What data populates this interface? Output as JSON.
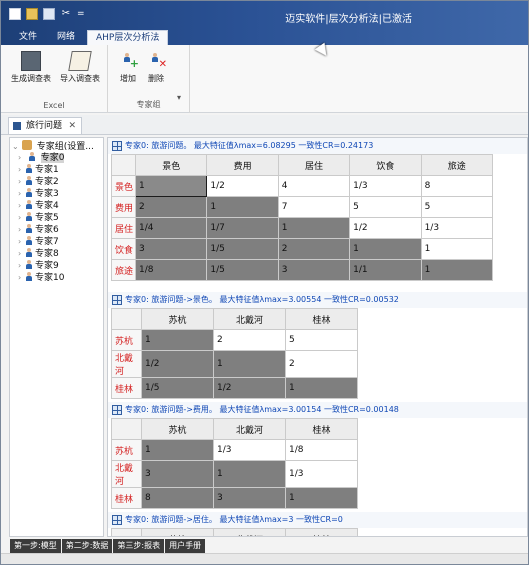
{
  "title": "迈实软件|层次分析法|已激活",
  "tabs": [
    "文件",
    "网络",
    "AHP层次分析法"
  ],
  "ribbon": {
    "excel_group": "Excel",
    "expert_group": "专家组",
    "buttons": {
      "generate": "生成调查表",
      "import": "导入调查表",
      "add": "增加",
      "delete": "删除"
    }
  },
  "document_tab": "旅行问题",
  "tree": {
    "root": "专家组(设置...",
    "items": [
      "专家0",
      "专家1",
      "专家2",
      "专家3",
      "专家4",
      "专家5",
      "专家6",
      "专家7",
      "专家8",
      "专家9",
      "专家10"
    ]
  },
  "sections": [
    {
      "title": "专家0: 旅游问题。 最大特征值λmax=6.08295 一致性CR=0.24173",
      "columns": [
        "景色",
        "费用",
        "居住",
        "饮食",
        "旅途"
      ],
      "rows": [
        [
          "景色",
          "1",
          "1/2",
          "4",
          "1/3",
          "8"
        ],
        [
          "费用",
          "2",
          "1",
          "7",
          "5",
          "5"
        ],
        [
          "居住",
          "1/4",
          "1/7",
          "1",
          "1/2",
          "1/3"
        ],
        [
          "饮食",
          "3",
          "1/5",
          "2",
          "1",
          "1"
        ],
        [
          "旅途",
          "1/8",
          "1/5",
          "3",
          "1/1",
          "1"
        ]
      ]
    },
    {
      "title": "专家0: 旅游问题->景色。 最大特征值λmax=3.00554 一致性CR=0.00532",
      "columns": [
        "苏杭",
        "北戴河",
        "桂林"
      ],
      "rows": [
        [
          "苏杭",
          "1",
          "2",
          "5"
        ],
        [
          "北戴河",
          "1/2",
          "1",
          "2"
        ],
        [
          "桂林",
          "1/5",
          "1/2",
          "1"
        ]
      ]
    },
    {
      "title": "专家0: 旅游问题->费用。 最大特征值λmax=3.00154 一致性CR=0.00148",
      "columns": [
        "苏杭",
        "北戴河",
        "桂林"
      ],
      "rows": [
        [
          "苏杭",
          "1",
          "1/3",
          "1/8"
        ],
        [
          "北戴河",
          "3",
          "1",
          "1/3"
        ],
        [
          "桂林",
          "8",
          "3",
          "1"
        ]
      ]
    },
    {
      "title": "专家0: 旅游问题->居住。 最大特征值λmax=3 一致性CR=0",
      "columns": [
        "苏杭",
        "北戴河",
        "桂林"
      ]
    }
  ],
  "bottom_tabs": [
    "第一步:模型",
    "第二步:数据",
    "第三步:报表",
    "用户手册"
  ]
}
